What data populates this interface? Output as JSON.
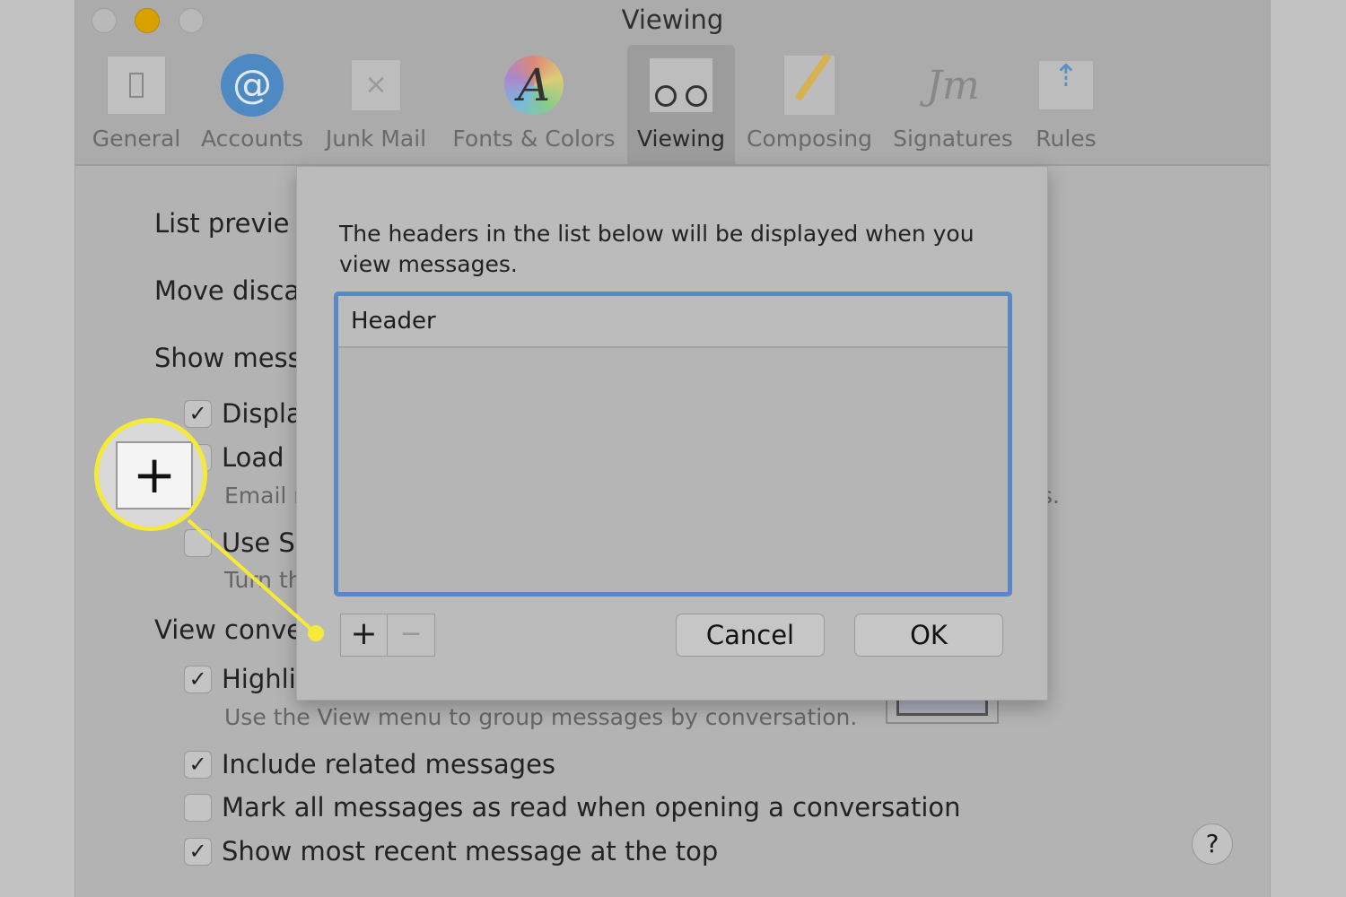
{
  "window": {
    "title": "Viewing"
  },
  "toolbar": {
    "tabs": [
      {
        "label": "General",
        "icon": "switch-icon"
      },
      {
        "label": "Accounts",
        "icon": "at-icon"
      },
      {
        "label": "Junk Mail",
        "icon": "trash-icon"
      },
      {
        "label": "Fonts & Colors",
        "icon": "font-color-icon"
      },
      {
        "label": "Viewing",
        "icon": "glasses-icon",
        "selected": true
      },
      {
        "label": "Composing",
        "icon": "pencil-icon"
      },
      {
        "label": "Signatures",
        "icon": "signature-icon"
      },
      {
        "label": "Rules",
        "icon": "rules-envelope-icon"
      }
    ]
  },
  "background": {
    "list_preview": "List previe",
    "move_discarded": "Move disca",
    "show_message": "Show mess",
    "display": "Displa",
    "load": "Load",
    "email": "Email r",
    "email_tail": "s.",
    "use_s": "Use S",
    "turn": "Turn th",
    "view_conv": "View conve",
    "highlight": "Highli",
    "highlight_sub": "Use the View menu to group messages by conversation.",
    "include_related": "Include related messages",
    "mark_all": "Mark all messages as read when opening a conversation",
    "show_recent": "Show most recent message at the top",
    "help": "?"
  },
  "dialog": {
    "description": "The headers in the list below will be displayed when you view messages.",
    "column_header": "Header",
    "add": "+",
    "remove": "−",
    "cancel": "Cancel",
    "ok": "OK"
  },
  "callout": {
    "symbol": "+",
    "color": "#f5e93a"
  }
}
